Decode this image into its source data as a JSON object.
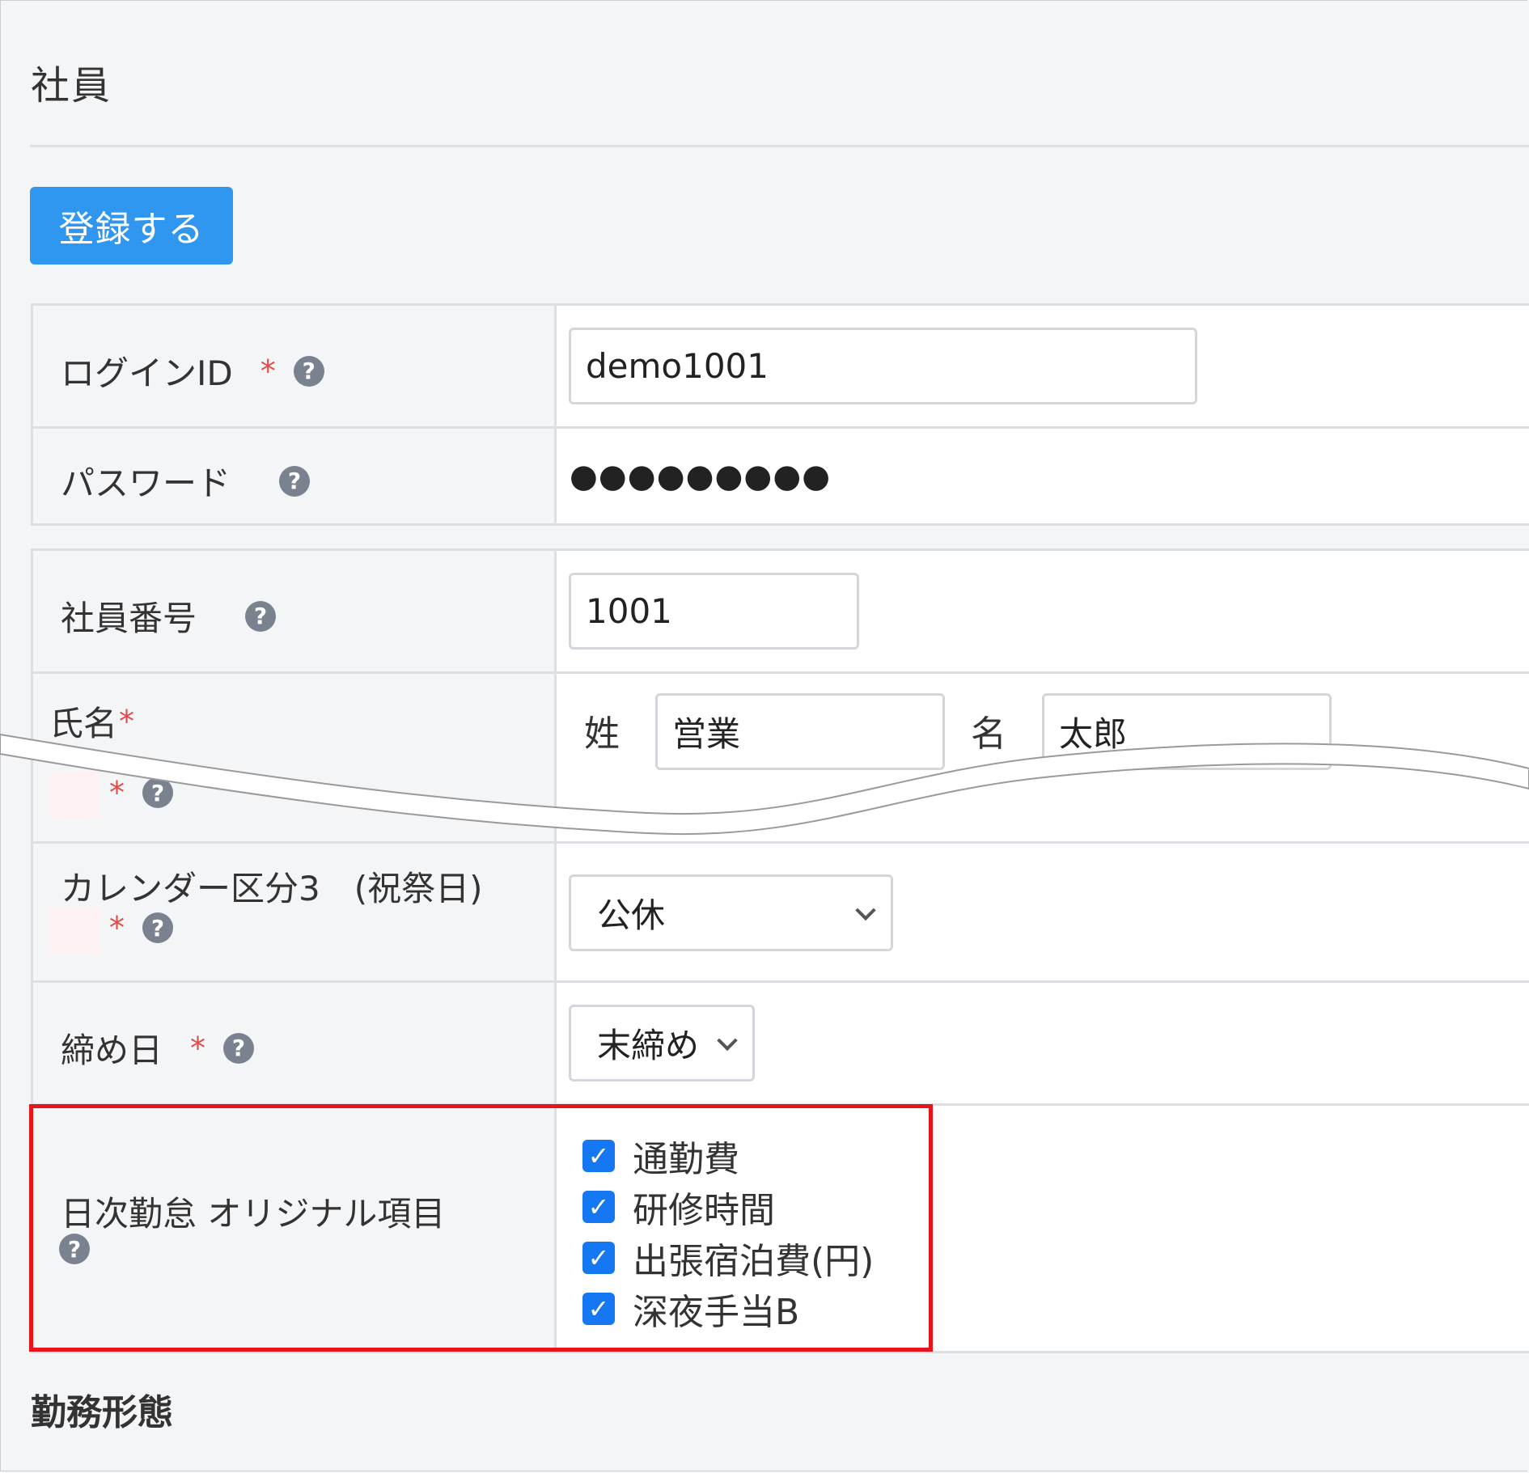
{
  "page": {
    "title": "社員",
    "register_button": "登録する",
    "section_title": "勤務形態"
  },
  "login": {
    "login_id_label": "ログインID",
    "login_id_value": "demo1001",
    "password_label": "パスワード",
    "password_value": "●●●●●●●●●"
  },
  "employee": {
    "number_label": "社員番号",
    "number_value": "1001",
    "name_label": "氏名",
    "last_name_label": "姓",
    "last_name_value": "営業",
    "first_name_label": "名",
    "first_name_value": "太郎",
    "calendar_label": "カレンダー区分3　(祝祭日)",
    "calendar_value": "公休",
    "closing_label": "締め日",
    "closing_value": "末締め",
    "daily_items_label": "日次勤怠 オリジナル項目",
    "daily_items": [
      {
        "label": "通勤費",
        "checked": true
      },
      {
        "label": "研修時間",
        "checked": true
      },
      {
        "label": "出張宿泊費(円)",
        "checked": true
      },
      {
        "label": "深夜手当B",
        "checked": true
      }
    ]
  },
  "symbols": {
    "required_mark": "*",
    "help_glyph": "?",
    "check_glyph": "✓"
  },
  "colors": {
    "primary": "#2f97f0",
    "checkbox": "#1677f2",
    "highlight": "#e8141a",
    "required": "#e24a4a"
  }
}
